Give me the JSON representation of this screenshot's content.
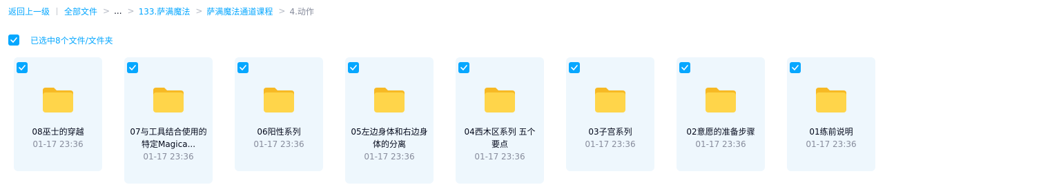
{
  "breadcrumb": {
    "back": "返回上一级",
    "all_files": "全部文件",
    "ellipsis": "...",
    "crumbs": [
      "133.萨满魔法",
      "萨满魔法通道课程"
    ],
    "current": "4.动作"
  },
  "selection": {
    "text": "已选中8个文件/文件夹"
  },
  "files": [
    {
      "name": "08巫士的穿越",
      "time": "01-17 23:36",
      "checked": true
    },
    {
      "name": "07与工具结合使用的特定Magica...",
      "time": "01-17 23:36",
      "checked": true
    },
    {
      "name": "06阳性系列",
      "time": "01-17 23:36",
      "checked": true
    },
    {
      "name": "05左边身体和右边身体的分离",
      "time": "01-17 23:36",
      "checked": true
    },
    {
      "name": "04西木区系列 五个要点",
      "time": "01-17 23:36",
      "checked": true
    },
    {
      "name": "03子宫系列",
      "time": "01-17 23:36",
      "checked": true
    },
    {
      "name": "02意愿的准备步骤",
      "time": "01-17 23:36",
      "checked": true
    },
    {
      "name": "01练前说明",
      "time": "01-17 23:36",
      "checked": true
    }
  ],
  "colors": {
    "accent": "#06a7ff",
    "card_bg": "#eef7fd",
    "folder_body": "#ffd54a",
    "folder_tab": "#f7b924",
    "muted_text": "#878c9c"
  },
  "icons": {
    "checkbox": "check-icon",
    "folder": "folder-icon"
  }
}
